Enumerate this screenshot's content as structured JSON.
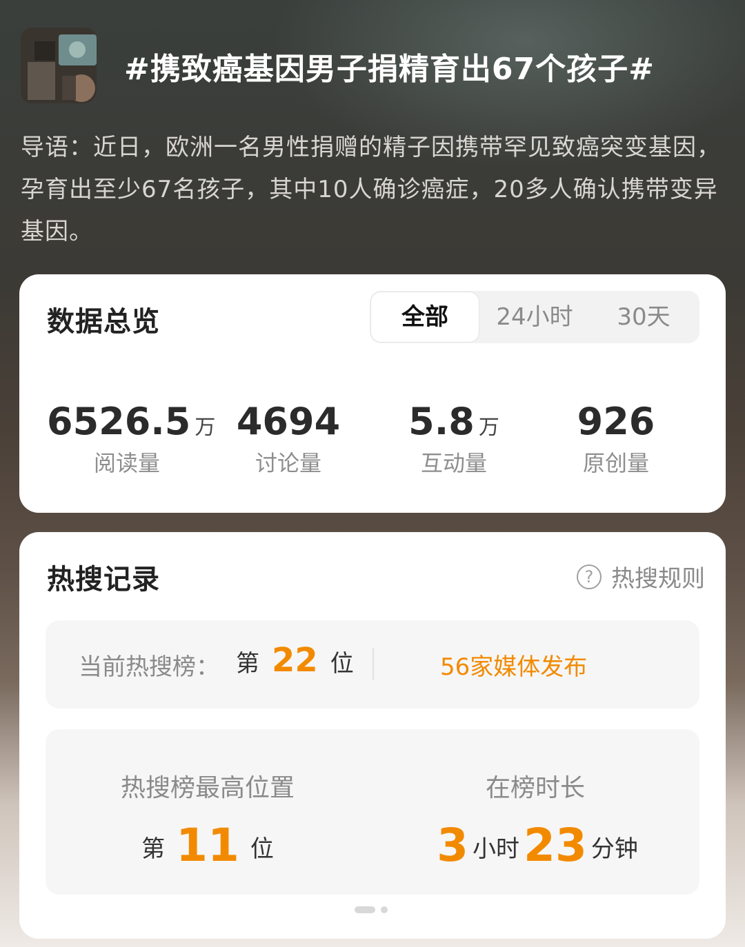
{
  "topic": {
    "title": "#携致癌基因男子捐精育出67个孩子#",
    "intro_label": "导语：",
    "intro_text": "近日，欧洲一名男性捐赠的精子因携带罕见致癌突变基因，孕育出至少67名孩子，其中10人确诊癌症，20多人确认携带变异基因。"
  },
  "overview": {
    "title": "数据总览",
    "tabs": [
      {
        "label": "全部",
        "active": true
      },
      {
        "label": "24小时",
        "active": false
      },
      {
        "label": "30天",
        "active": false
      }
    ],
    "stats": [
      {
        "value": "6526.5",
        "unit": "万",
        "label": "阅读量"
      },
      {
        "value": "4694",
        "unit": "",
        "label": "讨论量"
      },
      {
        "value": "5.8",
        "unit": "万",
        "label": "互动量"
      },
      {
        "value": "926",
        "unit": "",
        "label": "原创量"
      }
    ]
  },
  "hot": {
    "title": "热搜记录",
    "rules_label": "热搜规则",
    "current_label": "当前热搜榜：",
    "rank_prefix": "第",
    "current_rank": "22",
    "rank_suffix": "位",
    "media_text": "56家媒体发布",
    "best_label": "热搜榜最高位置",
    "best_rank": "11",
    "duration_label": "在榜时长",
    "duration_hours": "3",
    "hours_unit": "小时",
    "duration_minutes": "23",
    "minutes_unit": "分钟"
  },
  "colors": {
    "accent": "#f28a00",
    "card": "#ffffff",
    "panel": "#f6f6f6"
  }
}
